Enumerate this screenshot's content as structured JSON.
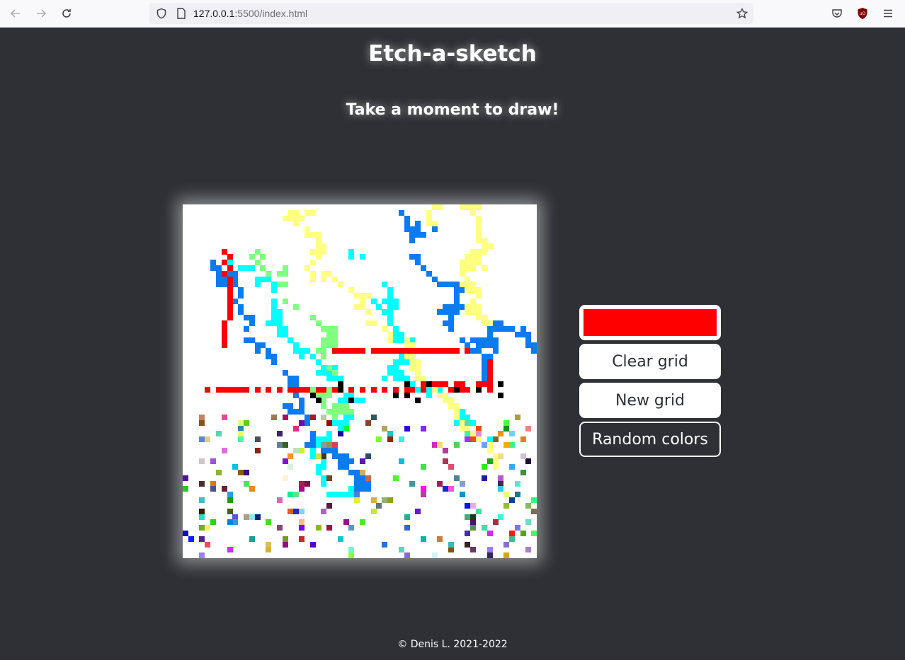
{
  "browser": {
    "url_host": "127.0.0.1",
    "url_rest": ":5500/index.html",
    "icons": [
      "back-arrow-icon",
      "forward-arrow-icon",
      "reload-icon",
      "shield-icon",
      "page-icon",
      "bookmark-star-icon",
      "pocket-icon",
      "ublock-icon",
      "menu-icon"
    ]
  },
  "page": {
    "title": "Etch-a-sketch",
    "subtitle": "Take a moment to draw!",
    "footer": "© Denis L. 2021-2022"
  },
  "controls": {
    "selected_color": "#ff0000",
    "clear_label": "Clear grid",
    "new_label": "New grid",
    "random_label": "Random colors"
  },
  "grid": {
    "size": 64,
    "background": "#ffffff",
    "palette": [
      "#ff0000",
      "#0a7cf0",
      "#00ffff",
      "#ffff80",
      "#80ff80",
      "#000000"
    ]
  }
}
